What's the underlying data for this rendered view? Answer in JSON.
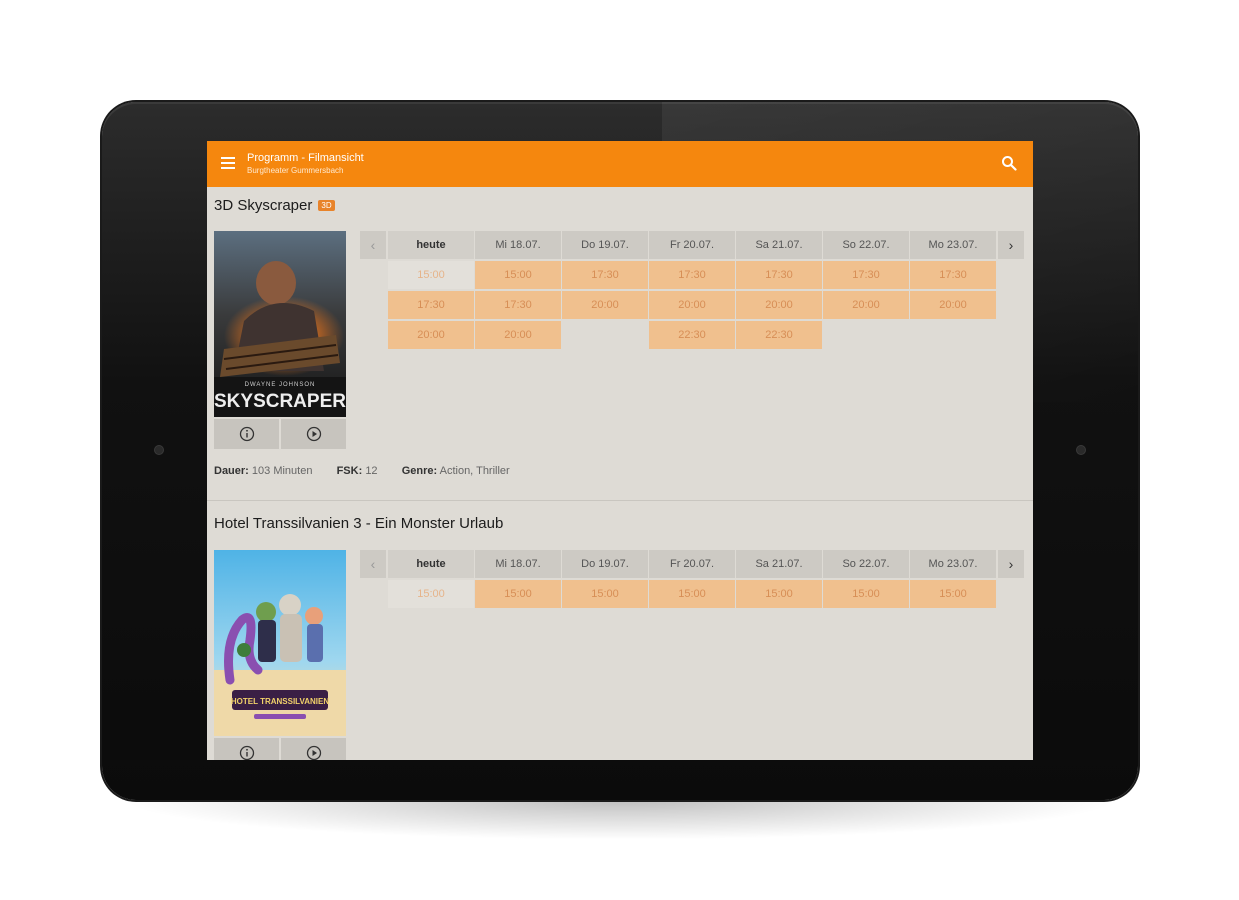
{
  "appbar": {
    "title": "Programm - Filmansicht",
    "subtitle": "Burgtheater Gummersbach",
    "background": "#f5870e"
  },
  "icons": {
    "menu": "menu-icon",
    "search": "search-icon",
    "info": "info-icon",
    "play": "play-icon",
    "prev": "chevron-left-icon",
    "next": "chevron-right-icon"
  },
  "colors": {
    "accent": "#f5870e",
    "slot": "#f0c08e",
    "screen": "#dedbd5"
  },
  "movies": [
    {
      "title": "3D Skyscraper",
      "badge": "3D",
      "poster": {
        "tagline": "DWAYNE JOHNSON",
        "name": "SKYSCRAPER"
      },
      "days": [
        "heute",
        "Mi 18.07.",
        "Do 19.07.",
        "Fr 20.07.",
        "Sa 21.07.",
        "So 22.07.",
        "Mo 23.07."
      ],
      "nav": {
        "prev": "‹",
        "next": "›"
      },
      "rows": [
        [
          "15:00",
          "15:00",
          "17:30",
          "17:30",
          "17:30",
          "17:30",
          "17:30"
        ],
        [
          "17:30",
          "17:30",
          "20:00",
          "20:00",
          "20:00",
          "20:00",
          "20:00"
        ],
        [
          "20:00",
          "20:00",
          "",
          "22:30",
          "22:30",
          "",
          ""
        ]
      ],
      "meta": {
        "duration_label": "Dauer:",
        "duration": "103 Minuten",
        "fsk_label": "FSK:",
        "fsk": "12",
        "genre_label": "Genre:",
        "genre": "Action, Thriller"
      }
    },
    {
      "title": "Hotel Transsilvanien 3 - Ein Monster Urlaub",
      "poster": {
        "name": "HOTEL TRANSSILVANIEN"
      },
      "days": [
        "heute",
        "Mi 18.07.",
        "Do 19.07.",
        "Fr 20.07.",
        "Sa 21.07.",
        "So 22.07.",
        "Mo 23.07."
      ],
      "nav": {
        "prev": "‹",
        "next": "›"
      },
      "rows": [
        [
          "15:00",
          "15:00",
          "15:00",
          "15:00",
          "15:00",
          "15:00",
          "15:00"
        ]
      ]
    }
  ]
}
